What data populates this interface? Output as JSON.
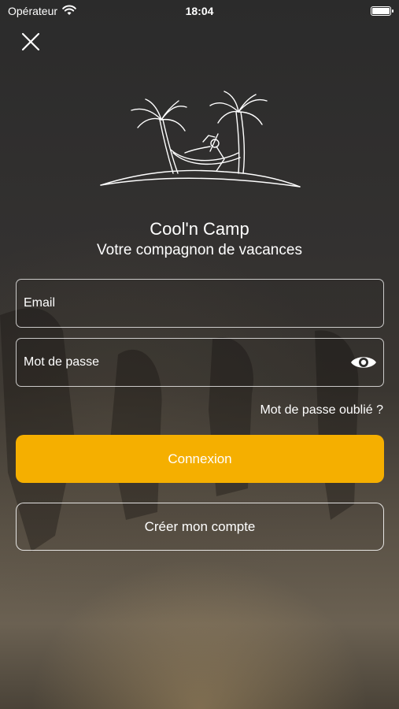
{
  "status_bar": {
    "carrier": "Opérateur",
    "time": "18:04"
  },
  "header": {
    "close_icon": "close-icon"
  },
  "brand": {
    "logo_icon": "palm-hammock-logo",
    "title": "Cool'n Camp",
    "subtitle": "Votre compagnon de vacances"
  },
  "form": {
    "email_placeholder": "Email",
    "password_placeholder": "Mot de passe",
    "forgot_label": "Mot de passe oublié ?",
    "login_label": "Connexion",
    "signup_label": "Créer mon compte"
  },
  "colors": {
    "accent": "#F5AF00",
    "text": "#FFFFFF"
  }
}
